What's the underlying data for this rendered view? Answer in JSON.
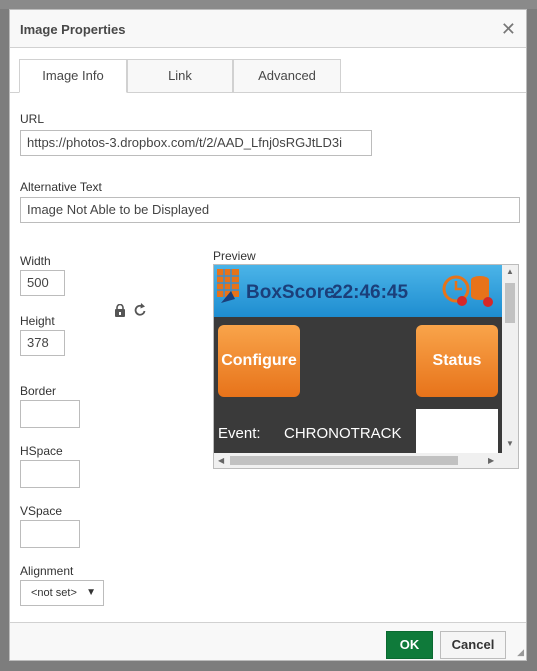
{
  "dialog": {
    "title": "Image Properties",
    "close_symbol": "✕"
  },
  "tabs": [
    {
      "label": "Image Info",
      "active": true
    },
    {
      "label": "Link",
      "active": false
    },
    {
      "label": "Advanced",
      "active": false
    }
  ],
  "url": {
    "label": "URL",
    "value": "https://photos-3.dropbox.com/t/2/AAD_Lfnj0sRGJtLD3i"
  },
  "alt_text": {
    "label": "Alternative Text",
    "value": "Image Not Able to be Displayed"
  },
  "width": {
    "label": "Width",
    "value": "500"
  },
  "height": {
    "label": "Height",
    "value": "378"
  },
  "border": {
    "label": "Border",
    "value": ""
  },
  "hspace": {
    "label": "HSpace",
    "value": ""
  },
  "vspace": {
    "label": "VSpace",
    "value": ""
  },
  "alignment": {
    "label": "Alignment",
    "value": "<not set>"
  },
  "icons": {
    "lock": "lock-icon",
    "reset": "reset-size-icon"
  },
  "preview": {
    "label": "Preview",
    "image_text": {
      "app_name": "BoxScore",
      "time": "22:46:45",
      "configure": "Configure",
      "status": "Status",
      "event_label": "Event:",
      "event_value": "CHRONOTRACK"
    }
  },
  "footer": {
    "ok_label": "OK",
    "cancel_label": "Cancel"
  },
  "colors": {
    "ok_button": "#0f7a3a",
    "header_blue": "#1e8dd0",
    "orange": "#e7731a"
  }
}
